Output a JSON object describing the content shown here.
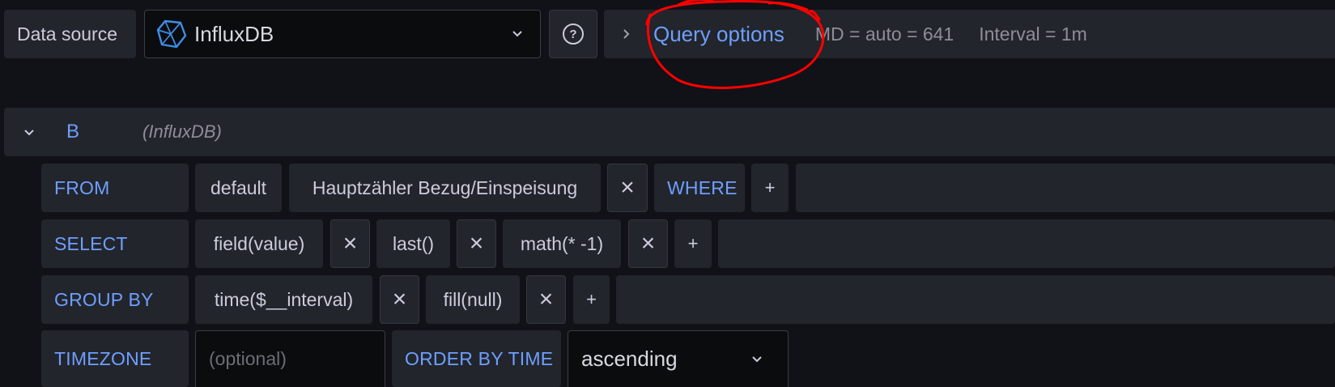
{
  "toolbar": {
    "datasource_label": "Data source",
    "datasource_value": "InfluxDB",
    "help_glyph": "?",
    "query_options_label": "Query options",
    "md_info": "MD = auto = 641",
    "interval_info": "Interval = 1m"
  },
  "query": {
    "ref_id": "B",
    "datasource_hint": "(InfluxDB)"
  },
  "rows": {
    "from": {
      "label": "FROM",
      "policy": "default",
      "measurement": "Hauptzähler Bezug/Einspeisung",
      "where_label": "WHERE"
    },
    "select": {
      "label": "SELECT",
      "field": "field(value)",
      "agg": "last()",
      "math": "math(* -1)"
    },
    "group_by": {
      "label": "GROUP BY",
      "time": "time($__interval)",
      "fill": "fill(null)"
    },
    "timezone": {
      "label": "TIMEZONE",
      "placeholder": "(optional)",
      "order_label": "ORDER BY TIME",
      "order_value": "ascending"
    }
  },
  "glyphs": {
    "remove": "×",
    "add": "+"
  },
  "icons": [
    "influxdb-logo-icon",
    "chevron-down-icon",
    "help-icon",
    "chevron-right-icon",
    "collapse-chevron-icon",
    "remove-icon",
    "add-icon"
  ],
  "colors": {
    "accent": "#6e9fff",
    "panel": "#22252b",
    "background": "#111217",
    "annotation": "#ff0000"
  }
}
